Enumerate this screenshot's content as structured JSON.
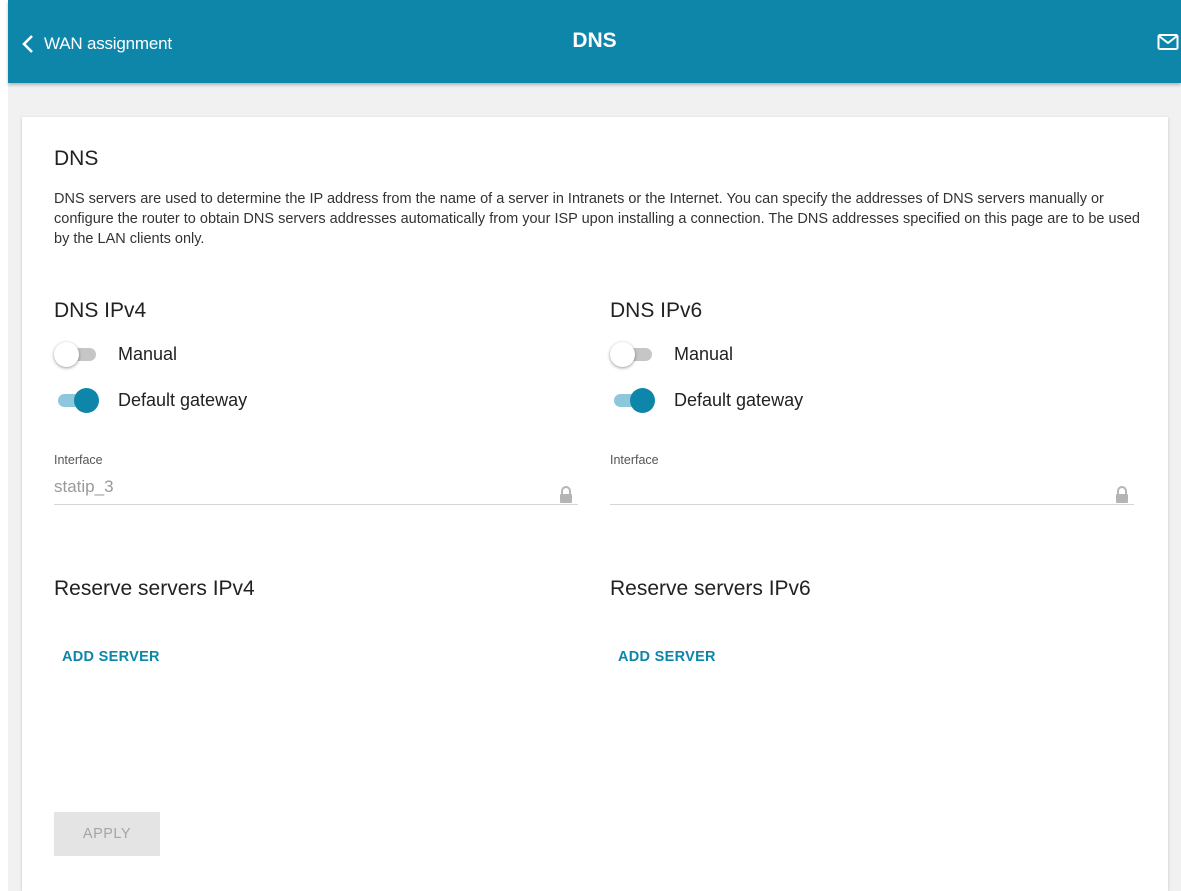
{
  "header": {
    "back_label": "WAN assignment",
    "title": "DNS",
    "accent_color": "#0d86aa"
  },
  "card": {
    "title": "DNS",
    "description": "DNS servers are used to determine the IP address from the name of a server in Intranets or the Internet. You can specify the addresses of DNS servers manually or configure the router to obtain DNS servers addresses automatically from your ISP upon installing a connection. The DNS addresses specified on this page are to be used by the LAN clients only."
  },
  "ipv4": {
    "title": "DNS IPv4",
    "manual_label": "Manual",
    "manual_on": false,
    "default_gateway_label": "Default gateway",
    "default_gateway_on": true,
    "interface_label": "Interface",
    "interface_value": "statip_3"
  },
  "ipv6": {
    "title": "DNS IPv6",
    "manual_label": "Manual",
    "manual_on": false,
    "default_gateway_label": "Default gateway",
    "default_gateway_on": true,
    "interface_label": "Interface",
    "interface_value": ""
  },
  "reserve_ipv4": {
    "title": "Reserve servers IPv4",
    "add_label": "ADD SERVER"
  },
  "reserve_ipv6": {
    "title": "Reserve servers IPv6",
    "add_label": "ADD SERVER"
  },
  "apply_label": "APPLY",
  "icons": {
    "back": "chevron-left-icon",
    "mail": "mail-icon",
    "lock": "lock-icon"
  }
}
